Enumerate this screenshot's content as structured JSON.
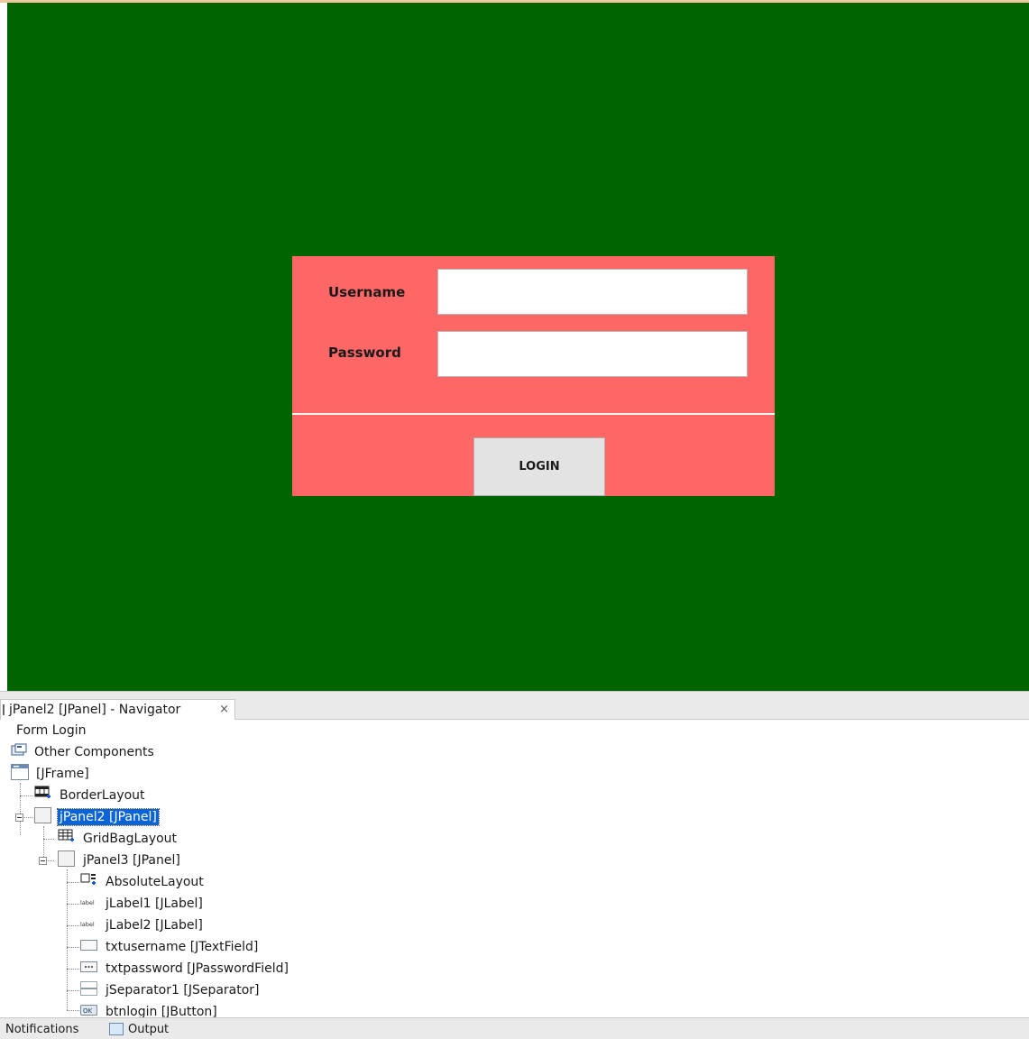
{
  "form": {
    "username_label": "Username",
    "password_label": "Password",
    "username_value": "",
    "password_value": "",
    "login_button": "LOGIN",
    "background_color": "#006400",
    "panel_color": "#ff6666"
  },
  "navigator": {
    "tab_title": "jPanel2 [JPanel] - Navigator",
    "close_label": "×",
    "tree": [
      {
        "label": "Form Login",
        "icon": "none"
      },
      {
        "label": "Other Components",
        "icon": "other-components-icon"
      },
      {
        "label": "[JFrame]",
        "icon": "jframe-icon"
      },
      {
        "label": "BorderLayout",
        "icon": "border-layout-icon"
      },
      {
        "label": "jPanel2 [JPanel]",
        "icon": "jpanel-icon",
        "selected": true
      },
      {
        "label": "GridBagLayout",
        "icon": "gridbag-layout-icon"
      },
      {
        "label": "jPanel3 [JPanel]",
        "icon": "jpanel-icon"
      },
      {
        "label": "AbsoluteLayout",
        "icon": "absolute-layout-icon"
      },
      {
        "label": "jLabel1 [JLabel]",
        "icon": "label-icon"
      },
      {
        "label": "jLabel2 [JLabel]",
        "icon": "label-icon"
      },
      {
        "label": "txtusername [JTextField]",
        "icon": "textfield-icon"
      },
      {
        "label": "txtpassword [JPasswordField]",
        "icon": "passwordfield-icon"
      },
      {
        "label": "jSeparator1 [JSeparator]",
        "icon": "separator-icon"
      },
      {
        "label": "btnlogin [JButton]",
        "icon": "button-icon"
      }
    ]
  },
  "status_bar": {
    "notifications": "Notifications",
    "output": "Output"
  }
}
